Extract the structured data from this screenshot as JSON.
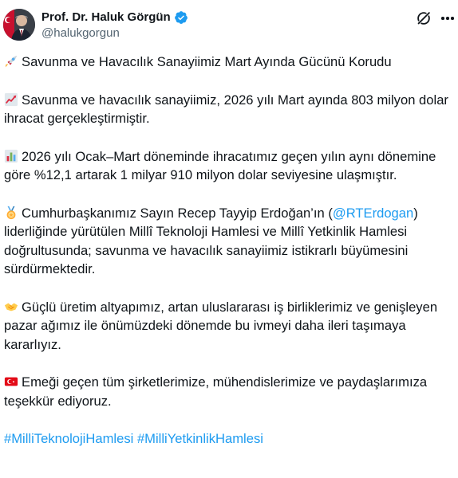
{
  "author": {
    "name": "Prof. Dr. Haluk Görgün",
    "handle": "@halukgorgun"
  },
  "icons": {
    "verified": "verified-badge-icon",
    "grok": "grok-icon",
    "more": "more-options-icon"
  },
  "colors": {
    "link": "#1d9bf0",
    "verified": "#1d9bf0",
    "text": "#0f1419",
    "secondary": "#536471"
  },
  "tweet": {
    "p1": {
      "emoji": "rocket",
      "text": "Savunma ve Havacılık Sanayiimiz Mart Ayında Gücünü Korudu"
    },
    "p2": {
      "emoji": "chart-increasing",
      "text": "Savunma ve havacılık sanayiimiz, 2026 yılı Mart ayında 803 milyon dolar ihracat gerçekleştirmiştir."
    },
    "p3": {
      "emoji": "bar-chart",
      "text": "2026 yılı Ocak–Mart döneminde ihracatımız geçen yılın aynı dönemine göre %12,1 artarak 1 milyar 910 milyon dolar seviyesine ulaşmıştır."
    },
    "p4": {
      "emoji": "medal",
      "text_before": "Cumhurbaşkanımız Sayın Recep Tayyip Erdoğan’ın (",
      "mention": "@RTErdogan",
      "text_after": ") liderliğinde yürütülen Millî Teknoloji Hamlesi ve Millî Yetkinlik Hamlesi doğrultusunda; savunma ve havacılık sanayiimiz istikrarlı büyümesini sürdürmektedir."
    },
    "p5": {
      "emoji": "handshake",
      "text": "Güçlü üretim altyapımız, artan uluslararası iş birliklerimiz ve genişleyen pazar ağımız ile önümüzdeki dönemde bu ivmeyi daha ileri taşımaya kararlıyız."
    },
    "p6": {
      "emoji": "flag-turkey",
      "text": "Emeği geçen tüm şirketlerimize, mühendislerimize ve paydaşlarımıza teşekkür ediyoruz."
    },
    "hashtags": {
      "h1": "#MilliTeknolojiHamlesi",
      "h2": "#MilliYetkinlikHamlesi"
    }
  }
}
